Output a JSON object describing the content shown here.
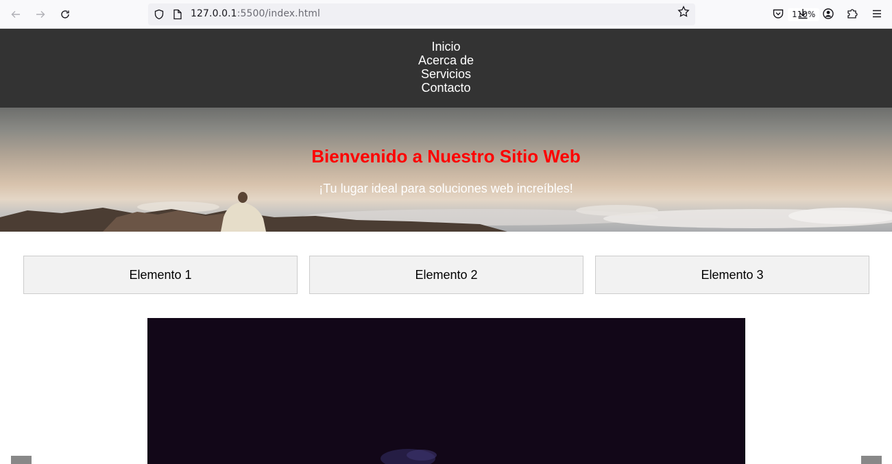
{
  "browser": {
    "url_host": "127.0.0.1",
    "url_rest": ":5500/index.html",
    "zoom": "110%"
  },
  "nav": {
    "items": [
      "Inicio",
      "Acerca de",
      "Servicios",
      "Contacto"
    ]
  },
  "hero": {
    "title": "Bienvenido a Nuestro Sitio Web",
    "subtitle": "¡Tu lugar ideal para soluciones web increíbles!"
  },
  "cards": [
    "Elemento 1",
    "Elemento 2",
    "Elemento 3"
  ],
  "colors": {
    "nav_bg": "#333333",
    "hero_title": "#ff0000",
    "card_bg": "#f2f2f2",
    "slider_bg": "#120718"
  }
}
